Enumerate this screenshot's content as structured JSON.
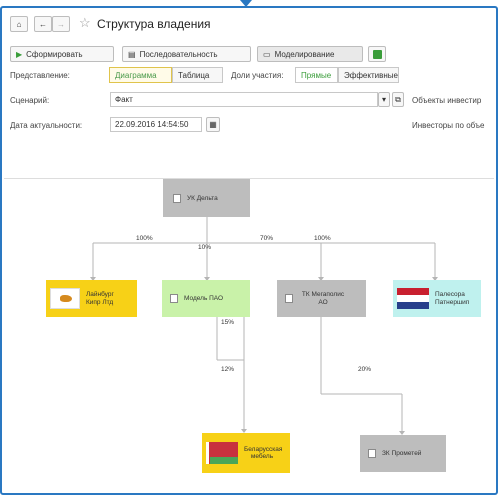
{
  "title": "Структура владения",
  "toolbar": {
    "form": "Сформировать",
    "sequence": "Последовательность",
    "modeling": "Моделирование"
  },
  "view": {
    "label": "Представление:",
    "diagram": "Диаграмма",
    "table": "Таблица",
    "shares_label": "Доли участия:",
    "direct": "Прямые",
    "effective": "Эффективные"
  },
  "scenario": {
    "label": "Сценарий:",
    "value": "Факт",
    "objects": "Объекты инвестир"
  },
  "date": {
    "label": "Дата актуальности:",
    "value": "22.09.2016 14:54:50",
    "investors": "Инвесторы по объе"
  },
  "nodes": {
    "uk_delta": "УК Дельта",
    "cyprus": "Лайнбург Кипр Лтд",
    "model_pao": "Модель ПАО",
    "tk_megapolis": "ТК Мегаполис АО",
    "palesora": "Палесора Патнершип",
    "belarus": "Беларусская мебель",
    "prometey": "ЗК Прометей"
  },
  "percents": {
    "p1": "100%",
    "p2": "10%",
    "p3": "70%",
    "p4": "100%",
    "p5": "15%",
    "p6": "12%",
    "p7": "20%"
  },
  "colors": {
    "accent": "#2a78c2",
    "gray_node": "#bdbdbd",
    "yellow_node": "#f7d117",
    "green_node": "#c9f2a9",
    "cyan_node": "#bff1ee"
  }
}
